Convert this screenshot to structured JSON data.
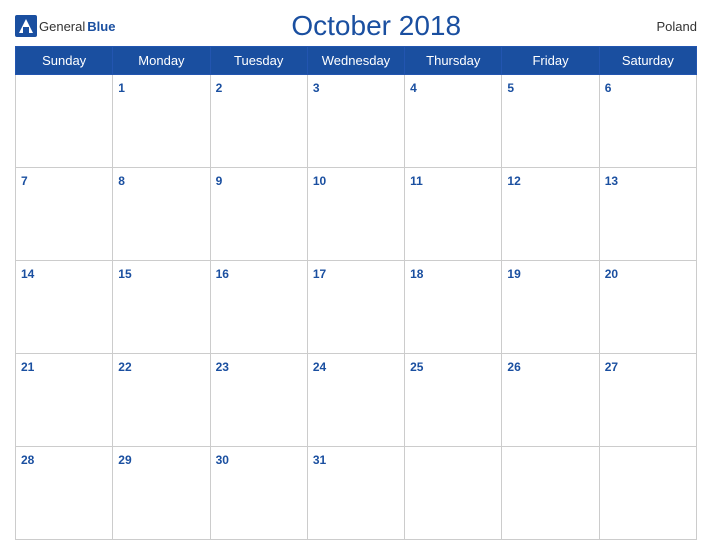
{
  "header": {
    "logo_general": "General",
    "logo_blue": "Blue",
    "title": "October 2018",
    "country": "Poland"
  },
  "days_of_week": [
    "Sunday",
    "Monday",
    "Tuesday",
    "Wednesday",
    "Thursday",
    "Friday",
    "Saturday"
  ],
  "weeks": [
    [
      null,
      1,
      2,
      3,
      4,
      5,
      6
    ],
    [
      7,
      8,
      9,
      10,
      11,
      12,
      13
    ],
    [
      14,
      15,
      16,
      17,
      18,
      19,
      20
    ],
    [
      21,
      22,
      23,
      24,
      25,
      26,
      27
    ],
    [
      28,
      29,
      30,
      31,
      null,
      null,
      null
    ]
  ]
}
